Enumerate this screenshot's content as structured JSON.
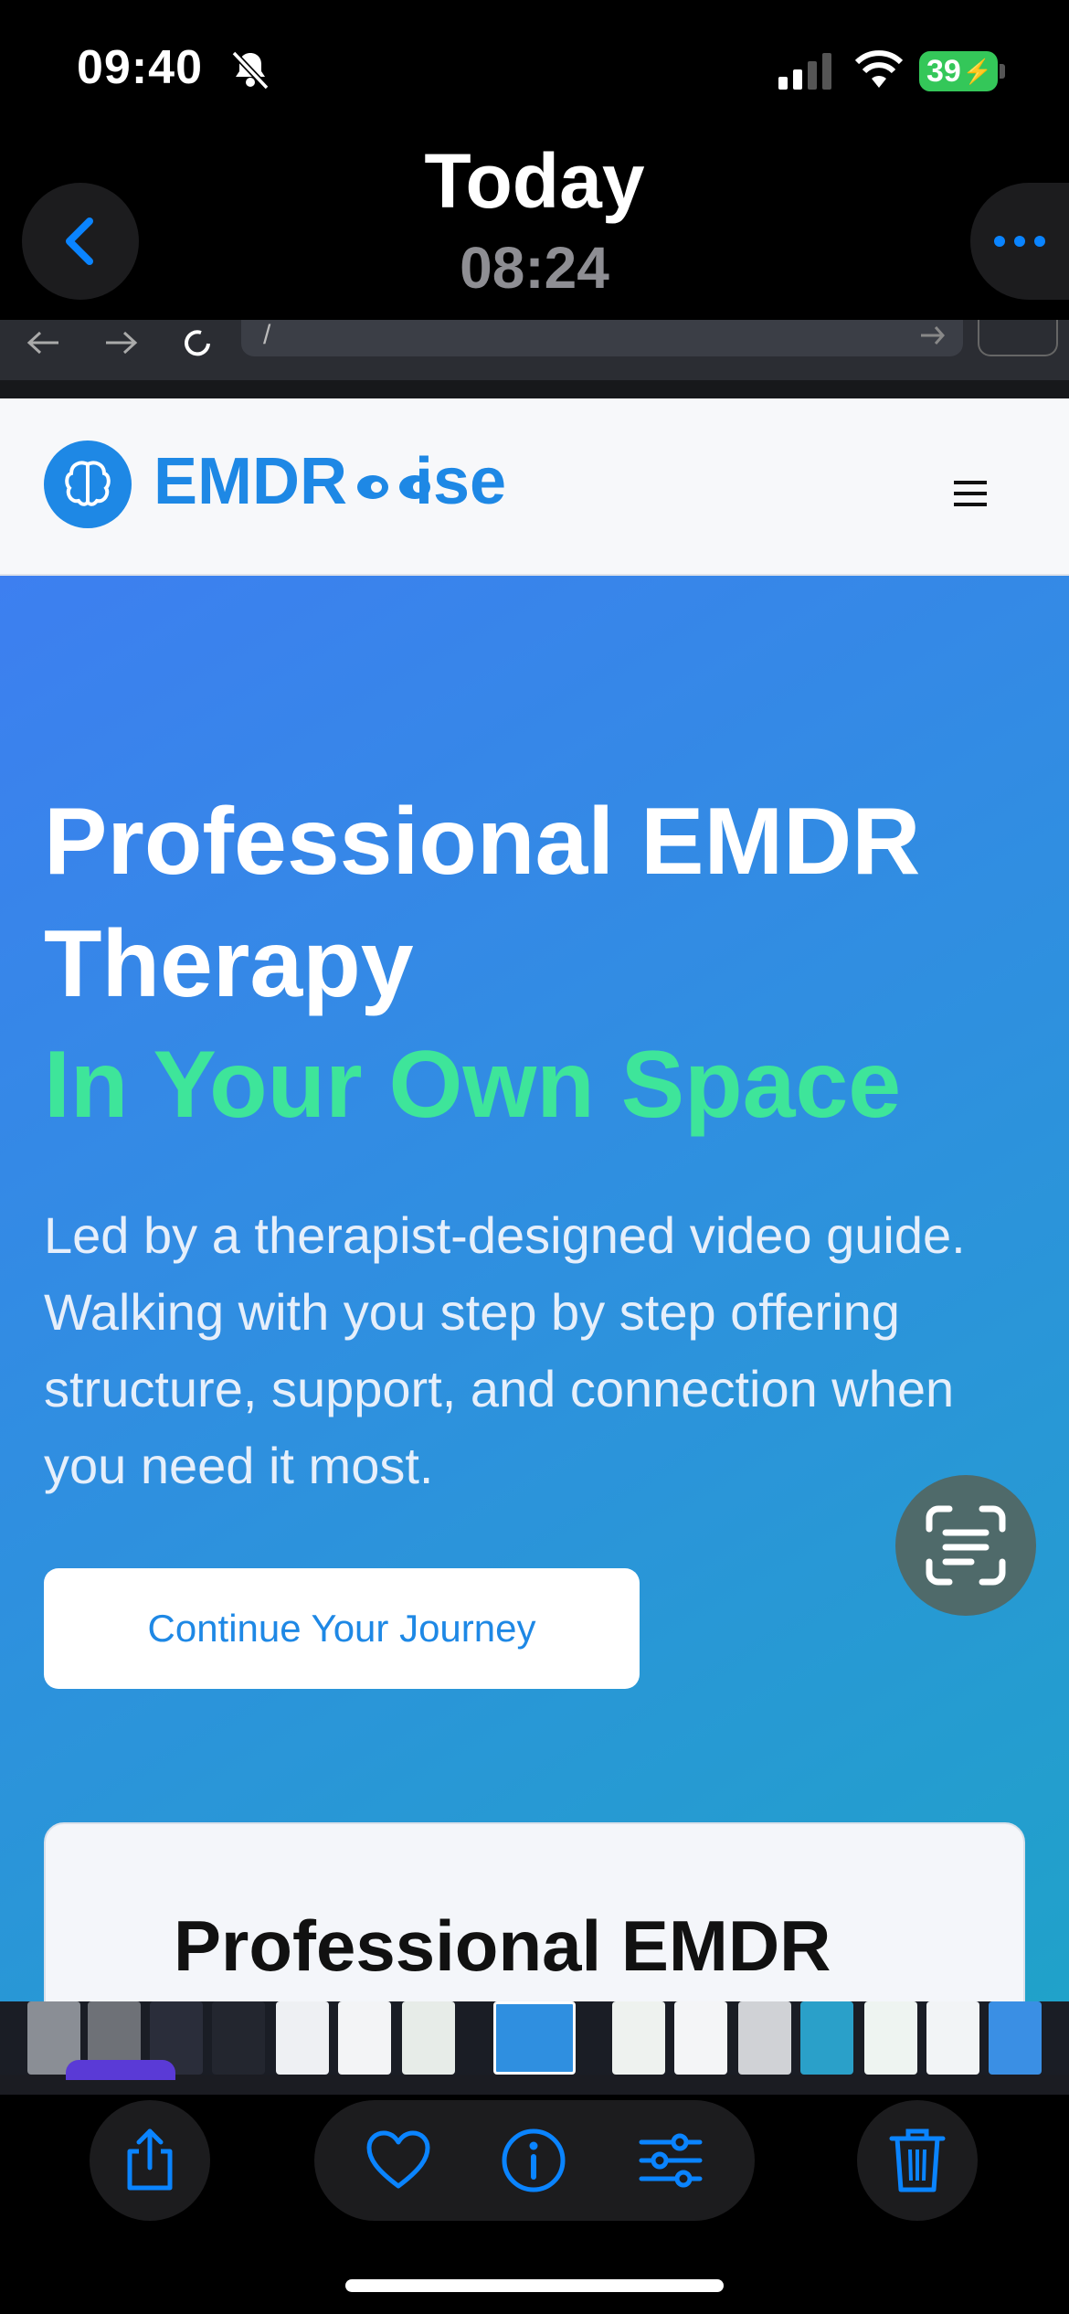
{
  "status_bar": {
    "time": "09:40",
    "battery_level": "39",
    "icons": [
      "bell-slash-icon",
      "cellular-signal-icon",
      "wifi-icon",
      "battery-charging-icon"
    ]
  },
  "photo_header": {
    "title": "Today",
    "subtitle": "08:24",
    "back_icon": "chevron-left-icon",
    "more_icon": "ellipsis-icon"
  },
  "screenshot_content": {
    "browser": {
      "url_text": "/",
      "icons": [
        "arrow-left-icon",
        "arrow-right-icon",
        "reload-icon",
        "go-arrow-icon",
        "open-external-icon"
      ]
    },
    "site_nav": {
      "logo_text_start": "EMDR",
      "logo_text_end": "ise",
      "logo_icon": "brain-icon",
      "menu_icon": "hamburger-menu-icon"
    },
    "hero": {
      "heading_line1": "Professional EMDR",
      "heading_line2": "Therapy",
      "heading_highlight": "In Your Own Space",
      "description": "Led by a therapist-designed video guide. Walking with you step by step offering structure, support, and connection when you need it most.",
      "cta_label": "Continue Your Journey",
      "card_heading": "Professional EMDR"
    },
    "colors": {
      "brand_blue": "#1e88e5",
      "highlight_green": "#3ee59a",
      "hero_gradient_start": "#3d7ff0",
      "hero_gradient_end": "#1fa3c8"
    }
  },
  "live_text_button": {
    "icon": "live-text-scan-icon"
  },
  "toolbar": {
    "share_icon": "share-icon",
    "favorite_icon": "heart-icon",
    "info_icon": "info-icon",
    "adjust_icon": "sliders-icon",
    "delete_icon": "trash-icon"
  }
}
